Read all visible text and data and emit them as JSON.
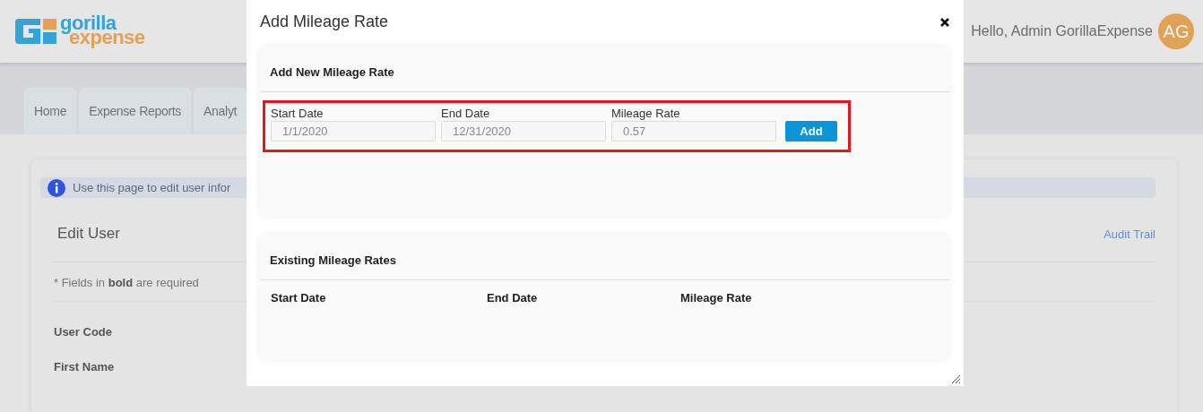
{
  "header": {
    "logo": {
      "primary": "gorilla",
      "secondary": "expense"
    },
    "greeting": "Hello, Admin GorillaExpense",
    "avatar": "AG"
  },
  "tabs": [
    "Home",
    "Expense Reports",
    "Analyt"
  ],
  "page": {
    "info": "Use this page to edit user infor",
    "title": "Edit User",
    "audit_link": "Audit Trail",
    "required_note": "* Fields in **bold** are required",
    "fields": [
      "User Code",
      "First Name"
    ]
  },
  "modal": {
    "title": "Add Mileage Rate",
    "new_section": {
      "title": "Add New Mileage Rate",
      "highlighted": true,
      "fields": [
        {
          "label": "Start Date",
          "value": "1/1/2020"
        },
        {
          "label": "End Date",
          "value": "12/31/2020"
        },
        {
          "label": "Mileage Rate",
          "value": "0.57"
        }
      ],
      "button": "Add"
    },
    "existing_section": {
      "title": "Existing Mileage Rates",
      "columns": [
        "Start Date",
        "End Date",
        "Mileage Rate"
      ]
    }
  }
}
